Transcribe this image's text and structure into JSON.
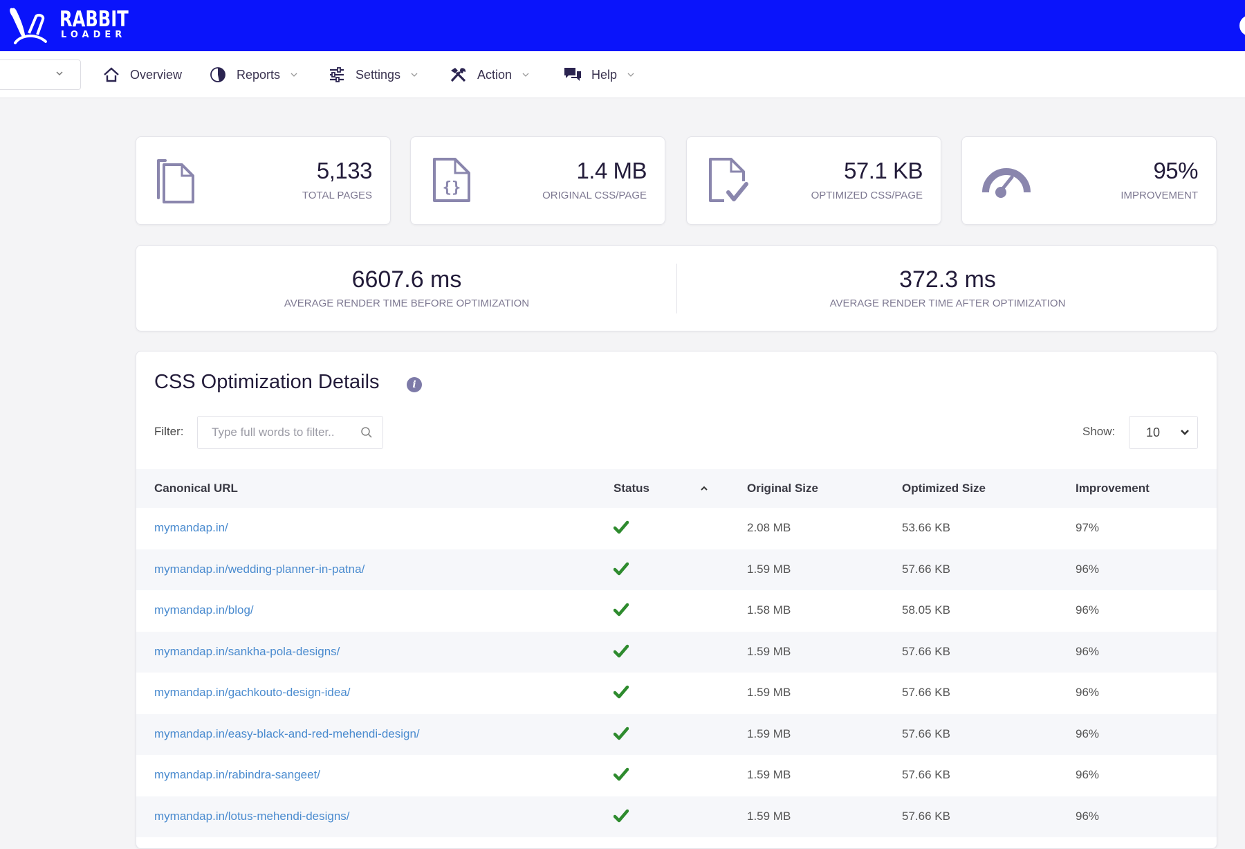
{
  "brand": {
    "name": "RABBIT",
    "sub": "LOADER",
    "color": "#0a14fb"
  },
  "nav": {
    "site_select_value": "",
    "items": [
      {
        "label": "Overview",
        "icon": "home-icon",
        "has_dropdown": false
      },
      {
        "label": "Reports",
        "icon": "pie-chart-icon",
        "has_dropdown": true
      },
      {
        "label": "Settings",
        "icon": "sliders-icon",
        "has_dropdown": true
      },
      {
        "label": "Action",
        "icon": "tools-icon",
        "has_dropdown": true
      },
      {
        "label": "Help",
        "icon": "chat-icon",
        "has_dropdown": true
      }
    ]
  },
  "stats": [
    {
      "value": "5,133",
      "label": "TOTAL PAGES",
      "icon": "pages-icon"
    },
    {
      "value": "1.4 MB",
      "label": "ORIGINAL CSS/PAGE",
      "icon": "css-file-icon"
    },
    {
      "value": "57.1 KB",
      "label": "OPTIMIZED CSS/PAGE",
      "icon": "file-check-icon"
    },
    {
      "value": "95%",
      "label": "IMPROVEMENT",
      "icon": "speedometer-icon"
    }
  ],
  "render": {
    "before": {
      "value": "6607.6 ms",
      "label": "AVERAGE RENDER TIME BEFORE OPTIMIZATION"
    },
    "after": {
      "value": "372.3 ms",
      "label": "AVERAGE RENDER TIME AFTER OPTIMIZATION"
    }
  },
  "details": {
    "title": "CSS Optimization Details",
    "filter_label": "Filter:",
    "filter_placeholder": "Type full words to filter..",
    "filter_value": "",
    "show_label": "Show:",
    "show_value": "10",
    "columns": [
      "Canonical URL",
      "Status",
      "Original Size",
      "Optimized Size",
      "Improvement"
    ],
    "sort_direction": "ascending",
    "rows": [
      {
        "url": "mymandap.in/",
        "status": "done",
        "original": "2.08 MB",
        "optimized": "53.66 KB",
        "improvement": "97%"
      },
      {
        "url": "mymandap.in/wedding-planner-in-patna/",
        "status": "done",
        "original": "1.59 MB",
        "optimized": "57.66 KB",
        "improvement": "96%"
      },
      {
        "url": "mymandap.in/blog/",
        "status": "done",
        "original": "1.58 MB",
        "optimized": "58.05 KB",
        "improvement": "96%"
      },
      {
        "url": "mymandap.in/sankha-pola-designs/",
        "status": "done",
        "original": "1.59 MB",
        "optimized": "57.66 KB",
        "improvement": "96%"
      },
      {
        "url": "mymandap.in/gachkouto-design-idea/",
        "status": "done",
        "original": "1.59 MB",
        "optimized": "57.66 KB",
        "improvement": "96%"
      },
      {
        "url": "mymandap.in/easy-black-and-red-mehendi-design/",
        "status": "done",
        "original": "1.59 MB",
        "optimized": "57.66 KB",
        "improvement": "96%"
      },
      {
        "url": "mymandap.in/rabindra-sangeet/",
        "status": "done",
        "original": "1.59 MB",
        "optimized": "57.66 KB",
        "improvement": "96%"
      },
      {
        "url": "mymandap.in/lotus-mehendi-designs/",
        "status": "done",
        "original": "1.59 MB",
        "optimized": "57.66 KB",
        "improvement": "96%"
      }
    ]
  },
  "colors": {
    "accent": "#0a14fb",
    "icon": "#8a86ad",
    "link": "#4a8bcf",
    "success": "#2e8b2e"
  }
}
